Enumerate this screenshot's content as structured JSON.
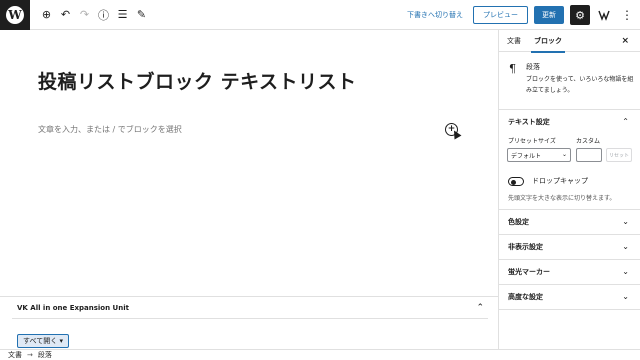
{
  "toolbar": {
    "logo_letter": "W",
    "tools": [
      {
        "icon": "plus-circle-icon",
        "glyph": "⊕"
      },
      {
        "icon": "undo-icon",
        "glyph": "↶"
      },
      {
        "icon": "redo-icon",
        "glyph": "↷"
      },
      {
        "icon": "info-icon",
        "glyph": "ⓘ"
      },
      {
        "icon": "list-view-icon",
        "glyph": "☰"
      },
      {
        "icon": "edit-pencil-icon",
        "glyph": "✎"
      }
    ],
    "save_draft_label": "下書きへ切り替え",
    "preview_label": "プレビュー",
    "update_label": "更新",
    "settings_glyph": "⚙",
    "plugin_glyph": "⚐",
    "more_glyph": "⋮"
  },
  "editor": {
    "post_title": "投稿リストブロック テキストリスト",
    "paragraph_placeholder": "文章を入力、または / でブロックを選択",
    "inserter_glyph": "+"
  },
  "metabox": {
    "title": "VK All in one Expansion Unit",
    "chevron": "⌃",
    "open_all_label": "すべて開く ▾"
  },
  "breadcrumb": {
    "items": [
      "文書",
      "段落"
    ],
    "separator": "→"
  },
  "sidebar": {
    "tabs": [
      "文書",
      "ブロック"
    ],
    "active_tab": "ブロック",
    "close_glyph": "×",
    "block": {
      "icon_glyph": "¶",
      "name": "段落",
      "description": "ブロックを使って、いろいろな物語を組み立てましょう。"
    },
    "text_settings": {
      "title": "テキスト設定",
      "chevron": "⌃",
      "preset_size_label": "プリセットサイズ",
      "custom_label": "カスタム",
      "preset_value": "デフォルト",
      "reset_label": "リセット",
      "dropcap_label": "ドロップキャップ",
      "dropcap_help": "先頭文字を大きな表示に切り替えます。"
    },
    "panels": [
      {
        "title": "色設定",
        "chevron": "⌄"
      },
      {
        "title": "非表示設定",
        "chevron": "⌄"
      },
      {
        "title": "蛍光マーカー",
        "chevron": "⌄"
      },
      {
        "title": "高度な設定",
        "chevron": "⌄"
      }
    ]
  },
  "colors": {
    "accent": "#2271b1",
    "dark": "#1e1e1e",
    "border": "#e0e0e0"
  }
}
